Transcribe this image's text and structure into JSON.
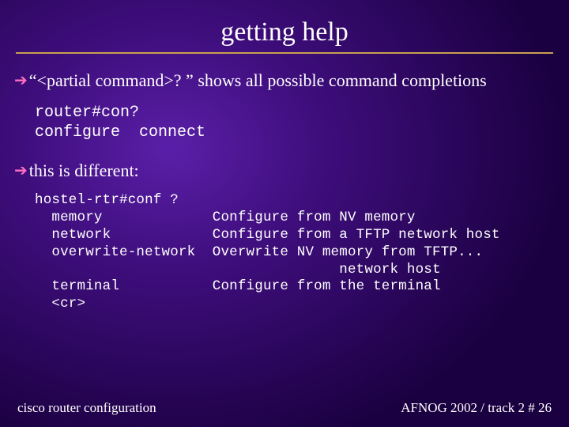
{
  "title": "getting help",
  "bullets": [
    {
      "text": "“<partial command>? ” shows all possible command completions"
    },
    {
      "text": "this is different:"
    }
  ],
  "code1": "router#con?\nconfigure  connect",
  "code2": "hostel-rtr#conf ?\n  memory             Configure from NV memory\n  network            Configure from a TFTP network host\n  overwrite-network  Overwrite NV memory from TFTP...\n                                    network host\n  terminal           Configure from the terminal\n  <cr>",
  "footer": {
    "left": "cisco router configuration",
    "right": "AFNOG 2002 / track 2  # 26"
  }
}
